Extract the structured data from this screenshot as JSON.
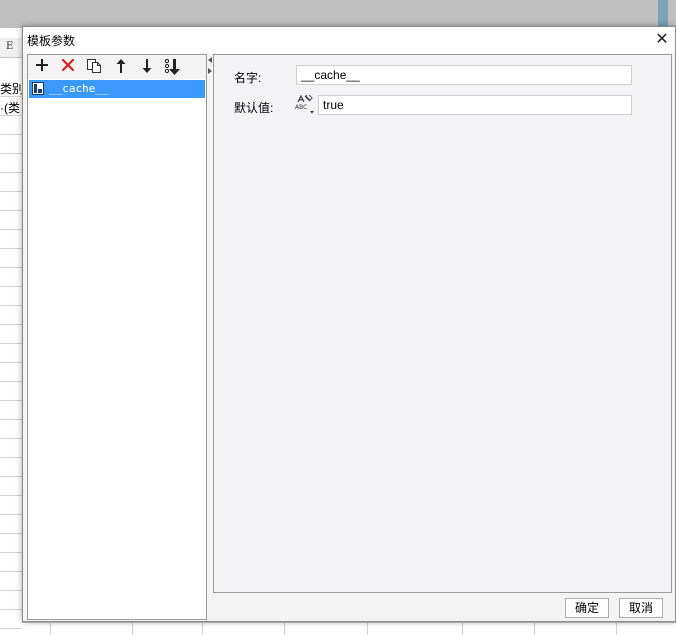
{
  "background": {
    "column_header": "E",
    "cells": [
      "类别",
      "·(类"
    ]
  },
  "dialog": {
    "title": "模板参数",
    "close_glyph": "✕",
    "toolbar": {
      "add_icon": "plus-icon",
      "delete_icon": "delete-x-icon",
      "copy_icon": "copy-icon",
      "move_up_icon": "arrow-up-icon",
      "move_down_icon": "arrow-down-icon",
      "sort_icon": "sort-icon"
    },
    "parameters": [
      {
        "name": "__cache__",
        "icon": "parameter-icon",
        "selected": true
      }
    ],
    "form": {
      "name_label": "名字:",
      "name_value": "__cache__",
      "default_label": "默认值:",
      "default_type_icon": "text-type-icon",
      "default_value": "true"
    },
    "buttons": {
      "ok": "确定",
      "cancel": "取消"
    }
  },
  "colors": {
    "selection": "#3b99fc",
    "delete_red": "#e02020",
    "panel_bg": "#f3f3f5"
  }
}
